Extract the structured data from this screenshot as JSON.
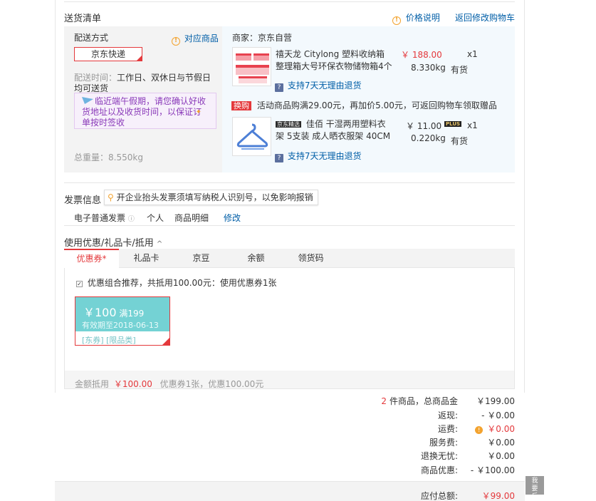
{
  "delivery": {
    "title": "送货清单",
    "price_note": "价格说明",
    "back_to_cart": "返回修改购物车",
    "method_label": "配送方式",
    "applicable_goods": "对应商品",
    "method_value": "京东快递",
    "time_label": "配送时间：",
    "time_value": "工作日、双休日与节假日均可送货",
    "holiday_notice": "临近端午假期，请您确认好收货地址以及收货时间，以保证订单按时签收",
    "total_weight_label": "总重量：",
    "total_weight": "8.550kg"
  },
  "seller": {
    "label": "商家：",
    "name": "京东自营"
  },
  "items": [
    {
      "title": "禧天龙 Citylong 塑料收纳箱整理箱大号环保衣物储物箱4个",
      "price": "￥ 188.00",
      "qty": "x1",
      "weight": "8.330kg",
      "stock": "有货",
      "return_policy": "支持7天无理由退货"
    },
    {
      "title": "佳佰 干湿两用塑料衣架 5支装 成人晒衣服架 40CM",
      "brand_tag": "京东精选",
      "price": "￥ 11.00",
      "plus_tag": "PLUS",
      "qty": "x1",
      "weight": "0.220kg",
      "stock": "有货",
      "return_policy": "支持7天无理由退货"
    }
  ],
  "promo": {
    "badge": "换购",
    "text": "活动商品购满29.00元，再加价5.00元，可返回购物车领取赠品"
  },
  "invoice": {
    "title": "发票信息",
    "tip": "开企业抬头发票须填写纳税人识别号，以免影响报销",
    "type": "电子普通发票",
    "holder": "个人",
    "content": "商品明细",
    "edit": "修改"
  },
  "discount": {
    "title": "使用优惠/礼品卡/抵用",
    "tabs": [
      "优惠券*",
      "礼品卡",
      "京豆",
      "余额",
      "领货码"
    ],
    "active_tab": 0,
    "recommend": "优惠组合推荐，共抵用100.00元：使用优惠券1张",
    "coupon": {
      "amount": "￥100",
      "condition": "满199",
      "expiry": "有效期至2018-06-13",
      "tags": "[东券] [限品类]"
    },
    "footer_label": "金额抵用",
    "footer_amount": "￥100.00",
    "footer_detail": "优惠券1张，优惠100.00元"
  },
  "summary": {
    "count": "2",
    "count_suffix": "件商品，总商品金",
    "goods_total": "￥199.00",
    "cashback_label": "返现:",
    "cashback": "- ￥0.00",
    "shipping_label": "运费:",
    "shipping": "￥0.00",
    "service_label": "服务费:",
    "service": "￥0.00",
    "return_label": "退换无忧:",
    "return_fee": "￥0.00",
    "discount_label": "商品优惠:",
    "discount": "- ￥100.00",
    "payable_label": "应付总额:",
    "payable": "￥99.00"
  },
  "side_tab": {
    "label": "我要反馈"
  },
  "colors": {
    "accent": "#e4393c",
    "link": "#005ea7",
    "coupon": "#74d2d4"
  }
}
